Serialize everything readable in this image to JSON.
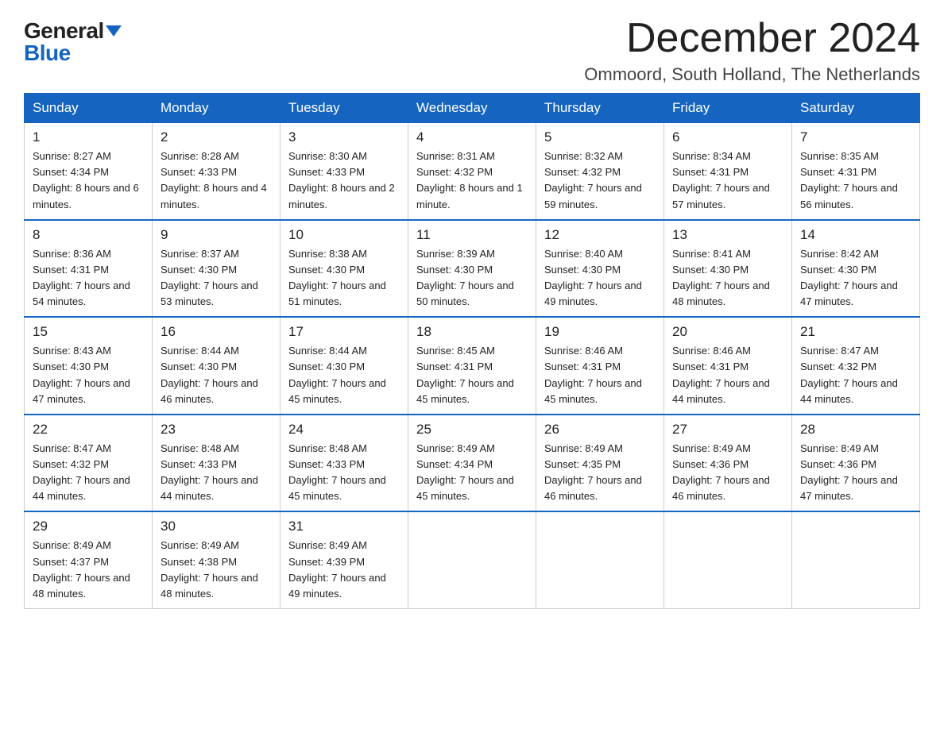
{
  "logo": {
    "general": "General",
    "blue": "Blue",
    "tagline": "GeneralBlue"
  },
  "title": {
    "month": "December 2024",
    "location": "Ommoord, South Holland, The Netherlands"
  },
  "headers": [
    "Sunday",
    "Monday",
    "Tuesday",
    "Wednesday",
    "Thursday",
    "Friday",
    "Saturday"
  ],
  "weeks": [
    [
      {
        "day": "1",
        "sunrise": "8:27 AM",
        "sunset": "4:34 PM",
        "daylight": "8 hours and 6 minutes."
      },
      {
        "day": "2",
        "sunrise": "8:28 AM",
        "sunset": "4:33 PM",
        "daylight": "8 hours and 4 minutes."
      },
      {
        "day": "3",
        "sunrise": "8:30 AM",
        "sunset": "4:33 PM",
        "daylight": "8 hours and 2 minutes."
      },
      {
        "day": "4",
        "sunrise": "8:31 AM",
        "sunset": "4:32 PM",
        "daylight": "8 hours and 1 minute."
      },
      {
        "day": "5",
        "sunrise": "8:32 AM",
        "sunset": "4:32 PM",
        "daylight": "7 hours and 59 minutes."
      },
      {
        "day": "6",
        "sunrise": "8:34 AM",
        "sunset": "4:31 PM",
        "daylight": "7 hours and 57 minutes."
      },
      {
        "day": "7",
        "sunrise": "8:35 AM",
        "sunset": "4:31 PM",
        "daylight": "7 hours and 56 minutes."
      }
    ],
    [
      {
        "day": "8",
        "sunrise": "8:36 AM",
        "sunset": "4:31 PM",
        "daylight": "7 hours and 54 minutes."
      },
      {
        "day": "9",
        "sunrise": "8:37 AM",
        "sunset": "4:30 PM",
        "daylight": "7 hours and 53 minutes."
      },
      {
        "day": "10",
        "sunrise": "8:38 AM",
        "sunset": "4:30 PM",
        "daylight": "7 hours and 51 minutes."
      },
      {
        "day": "11",
        "sunrise": "8:39 AM",
        "sunset": "4:30 PM",
        "daylight": "7 hours and 50 minutes."
      },
      {
        "day": "12",
        "sunrise": "8:40 AM",
        "sunset": "4:30 PM",
        "daylight": "7 hours and 49 minutes."
      },
      {
        "day": "13",
        "sunrise": "8:41 AM",
        "sunset": "4:30 PM",
        "daylight": "7 hours and 48 minutes."
      },
      {
        "day": "14",
        "sunrise": "8:42 AM",
        "sunset": "4:30 PM",
        "daylight": "7 hours and 47 minutes."
      }
    ],
    [
      {
        "day": "15",
        "sunrise": "8:43 AM",
        "sunset": "4:30 PM",
        "daylight": "7 hours and 47 minutes."
      },
      {
        "day": "16",
        "sunrise": "8:44 AM",
        "sunset": "4:30 PM",
        "daylight": "7 hours and 46 minutes."
      },
      {
        "day": "17",
        "sunrise": "8:44 AM",
        "sunset": "4:30 PM",
        "daylight": "7 hours and 45 minutes."
      },
      {
        "day": "18",
        "sunrise": "8:45 AM",
        "sunset": "4:31 PM",
        "daylight": "7 hours and 45 minutes."
      },
      {
        "day": "19",
        "sunrise": "8:46 AM",
        "sunset": "4:31 PM",
        "daylight": "7 hours and 45 minutes."
      },
      {
        "day": "20",
        "sunrise": "8:46 AM",
        "sunset": "4:31 PM",
        "daylight": "7 hours and 44 minutes."
      },
      {
        "day": "21",
        "sunrise": "8:47 AM",
        "sunset": "4:32 PM",
        "daylight": "7 hours and 44 minutes."
      }
    ],
    [
      {
        "day": "22",
        "sunrise": "8:47 AM",
        "sunset": "4:32 PM",
        "daylight": "7 hours and 44 minutes."
      },
      {
        "day": "23",
        "sunrise": "8:48 AM",
        "sunset": "4:33 PM",
        "daylight": "7 hours and 44 minutes."
      },
      {
        "day": "24",
        "sunrise": "8:48 AM",
        "sunset": "4:33 PM",
        "daylight": "7 hours and 45 minutes."
      },
      {
        "day": "25",
        "sunrise": "8:49 AM",
        "sunset": "4:34 PM",
        "daylight": "7 hours and 45 minutes."
      },
      {
        "day": "26",
        "sunrise": "8:49 AM",
        "sunset": "4:35 PM",
        "daylight": "7 hours and 46 minutes."
      },
      {
        "day": "27",
        "sunrise": "8:49 AM",
        "sunset": "4:36 PM",
        "daylight": "7 hours and 46 minutes."
      },
      {
        "day": "28",
        "sunrise": "8:49 AM",
        "sunset": "4:36 PM",
        "daylight": "7 hours and 47 minutes."
      }
    ],
    [
      {
        "day": "29",
        "sunrise": "8:49 AM",
        "sunset": "4:37 PM",
        "daylight": "7 hours and 48 minutes."
      },
      {
        "day": "30",
        "sunrise": "8:49 AM",
        "sunset": "4:38 PM",
        "daylight": "7 hours and 48 minutes."
      },
      {
        "day": "31",
        "sunrise": "8:49 AM",
        "sunset": "4:39 PM",
        "daylight": "7 hours and 49 minutes."
      },
      null,
      null,
      null,
      null
    ]
  ]
}
